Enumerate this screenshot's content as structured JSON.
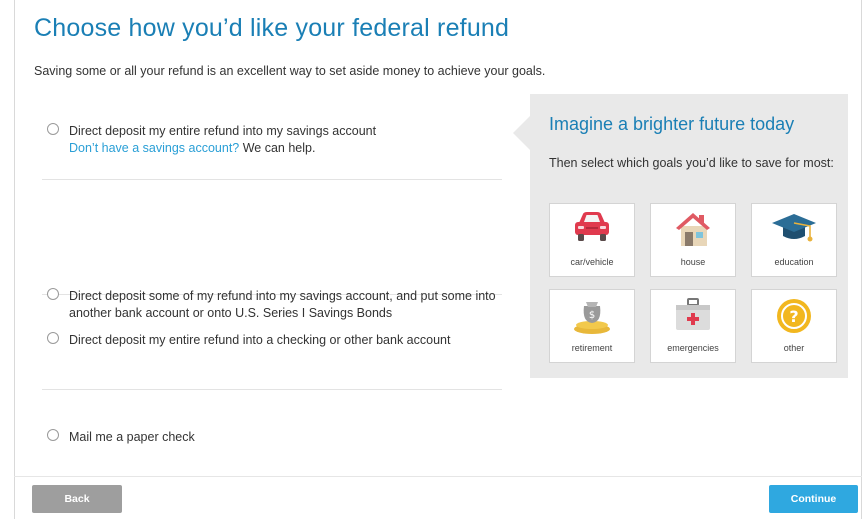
{
  "page": {
    "title": "Choose how you’d like your federal refund",
    "subtitle": "Saving some or all your refund is an excellent way to set aside money to achieve your goals."
  },
  "options": [
    {
      "line1": "Direct deposit my entire refund into my savings account",
      "link": "Don’t have a savings account?",
      "link_suffix": " We can help."
    },
    {
      "text": "Direct deposit some of my refund into my savings account, and put some into another bank account or onto U.S. Series I Savings Bonds"
    },
    {
      "text": "Direct deposit my entire refund into a checking or other bank account"
    },
    {
      "text": "Mail me a paper check"
    }
  ],
  "panel": {
    "title": "Imagine a brighter future today",
    "text": "Then select which goals you’d like to save for most:",
    "goals": [
      {
        "label": "car/vehicle",
        "icon": "car-icon"
      },
      {
        "label": "house",
        "icon": "house-icon"
      },
      {
        "label": "education",
        "icon": "graduation-cap-icon"
      },
      {
        "label": "retirement",
        "icon": "money-bag-icon"
      },
      {
        "label": "emergencies",
        "icon": "first-aid-kit-icon"
      },
      {
        "label": "other",
        "icon": "question-mark-icon"
      }
    ]
  },
  "footer": {
    "back_label": "Back",
    "continue_label": "Continue"
  },
  "colors": {
    "title_blue": "#1a7fb5",
    "link_blue": "#2a9fd6",
    "continue_blue": "#2fa8e0",
    "back_gray": "#9e9e9e",
    "panel_gray": "#e9e9e9"
  }
}
